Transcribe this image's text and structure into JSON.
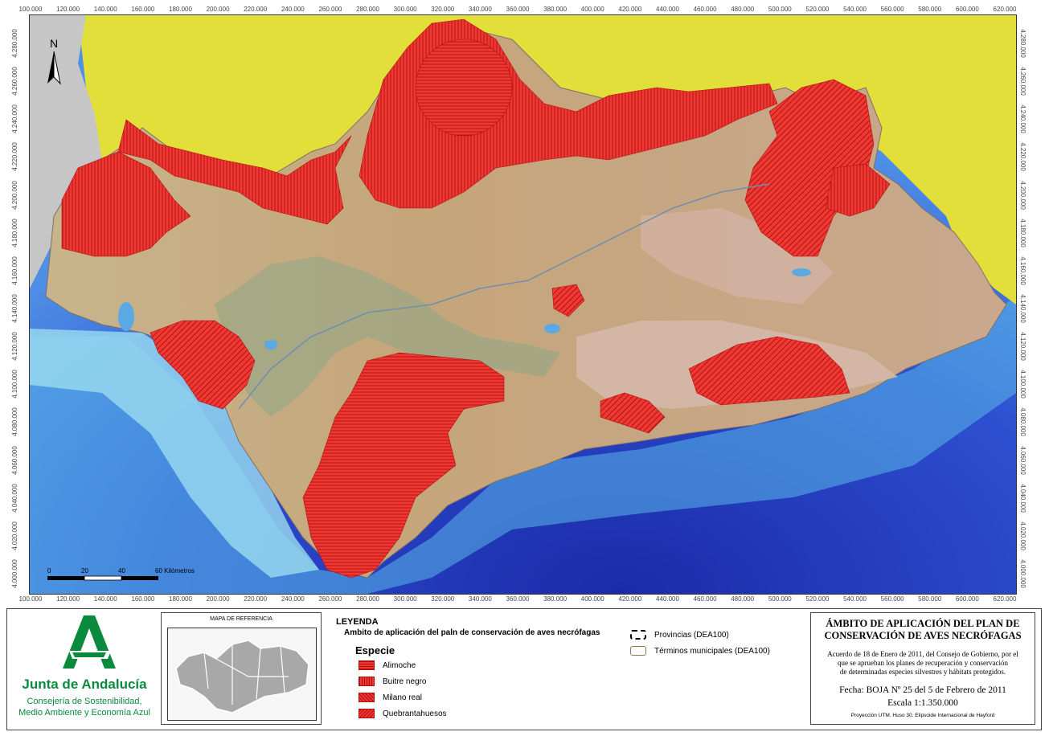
{
  "colors": {
    "species_red": "#e8252a",
    "outside_yellow": "#e2e03a",
    "sea_deep": "#2a3fc0",
    "sea_shallow": "#8fd4ee",
    "terrain": "#c9ab80",
    "portugal_grey": "#c4c4c4",
    "brand_green": "#0a8a3c"
  },
  "x_ticks": [
    "100.000",
    "120.000",
    "140.000",
    "160.000",
    "180.000",
    "200.000",
    "220.000",
    "240.000",
    "260.000",
    "280.000",
    "300.000",
    "320.000",
    "340.000",
    "360.000",
    "380.000",
    "400.000",
    "420.000",
    "440.000",
    "460.000",
    "480.000",
    "500.000",
    "520.000",
    "540.000",
    "560.000",
    "580.000",
    "600.000",
    "620.000"
  ],
  "y_ticks": [
    "4.280.000",
    "4.260.000",
    "4.240.000",
    "4.220.000",
    "4.200.000",
    "4.180.000",
    "4.160.000",
    "4.140.000",
    "4.120.000",
    "4.100.000",
    "4.080.000",
    "4.060.000",
    "4.040.000",
    "4.020.000",
    "4.000.000"
  ],
  "north_label": "N",
  "scale_bar": {
    "labels": [
      "0",
      "20",
      "40",
      "60 Kilómetros"
    ]
  },
  "logo": {
    "org_name": "Junta de Andalucía",
    "department_line1": "Consejería de Sostenibilidad,",
    "department_line2": "Medio Ambiente y Economía Azul"
  },
  "reference_map": {
    "title": "MAPA DE REFERENCIA"
  },
  "legend": {
    "title": "LEYENDA",
    "subtitle": "Ambito de aplicación del paln de conservación de aves necrófagas",
    "species_heading": "Especie",
    "species": [
      "Alimoche",
      "Buitre negro",
      "Milano real",
      "Quebrantahuesos"
    ],
    "layers": [
      "Provincias (DEA100)",
      "Términos municipales (DEA100)"
    ]
  },
  "title_block": {
    "title_line1": "ÁMBITO DE APLICACIÓN DEL PLAN DE",
    "title_line2": "CONSERVACIÓN DE AVES NECRÓFAGAS",
    "desc_line1": "Acuerdo de 18 de Enero de 2011, del Consejo de Gobierno, por el",
    "desc_line2": "que se aprueban los planes de recuperación y conservación",
    "desc_line3": "de determinadas especies silvestres y hábitats protegidos.",
    "date": "Fecha: BOJA Nº 25 del 5 de Febrero de 2011",
    "scale": "Escala   1:1.350.000",
    "projection": "Proyección UTM. Huso 30. Elipsoide Internacional de Hayford"
  }
}
